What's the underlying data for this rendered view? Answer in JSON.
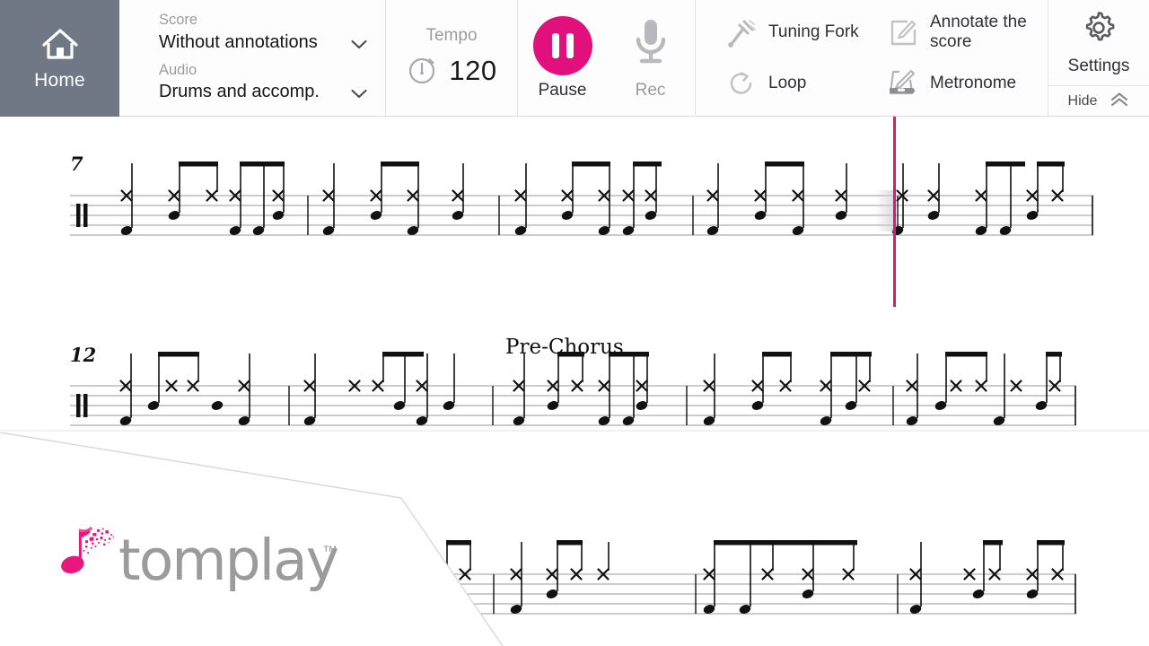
{
  "app": {
    "name": "Tomplay",
    "logo_wordmark": "tomplay",
    "logo_trademark": "™"
  },
  "colors": {
    "accent_pink": "#E2107C",
    "playhead": "#D81B72",
    "home_bg": "#707886",
    "muted_text": "#9C9C9C",
    "body_text": "#303036"
  },
  "toolbar": {
    "home": {
      "label": "Home",
      "icon": "home-icon"
    },
    "score_select": {
      "caption": "Score",
      "value": "Without annotations",
      "icon": "chevron-down-icon"
    },
    "audio_select": {
      "caption": "Audio",
      "value": "Drums and accomp.",
      "icon": "chevron-down-icon"
    },
    "tempo": {
      "caption": "Tempo",
      "value": "120",
      "icon": "stopwatch-icon"
    },
    "transport": [
      {
        "label": "Pause",
        "icon": "pause-icon",
        "state": "active"
      },
      {
        "label": "Rec",
        "icon": "microphone-icon",
        "state": "inactive"
      }
    ],
    "tools": [
      {
        "label": "Tuning Fork",
        "icon": "tuning-fork-icon"
      },
      {
        "label": "Annotate the score",
        "icon": "annotate-icon"
      },
      {
        "label": "Loop",
        "icon": "loop-icon"
      },
      {
        "label": "Metronome",
        "icon": "metronome-icon"
      }
    ],
    "settings": {
      "label": "Settings",
      "icon": "gear-icon"
    },
    "hide": {
      "label": "Hide",
      "icon": "double-chevron-up-icon"
    }
  },
  "score": {
    "instrument": "Drum kit",
    "systems": [
      {
        "measure_number": "7",
        "marking": ""
      },
      {
        "measure_number": "12",
        "marking": "Pre-Chorus"
      },
      {
        "measure_number": "",
        "marking": ""
      }
    ],
    "playhead_measure": "11"
  }
}
